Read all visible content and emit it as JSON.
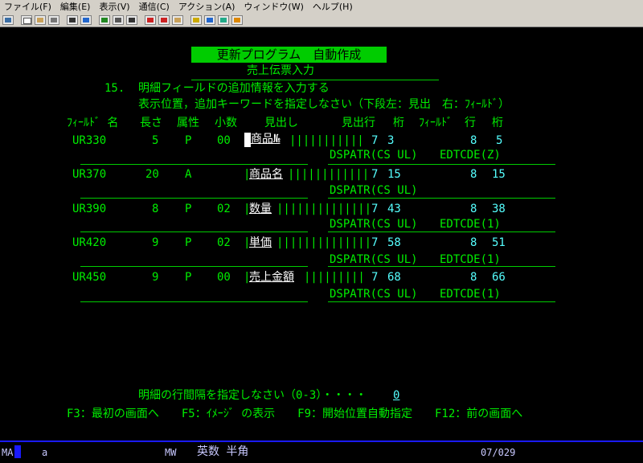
{
  "menu": [
    "ファイル(F)",
    "編集(E)",
    "表示(V)",
    "通信(C)",
    "アクション(A)",
    "ウィンドウ(W)",
    "ヘルプ(H)"
  ],
  "toolbar_icons": [
    "session-icon",
    "copy-icon",
    "paste-icon",
    "print-icon",
    "keyboard-icon",
    "macro-icon",
    "play-icon",
    "record-icon",
    "stop-icon",
    "transfer-icon",
    "receive-icon",
    "send-icon",
    "settings-icon",
    "help-icon",
    "globe-icon",
    "pencil-icon"
  ],
  "screen": {
    "title": "更新プログラム　自動作成",
    "subtitle": "売上伝票入力",
    "step": "15.",
    "instruction1": "明細フィールドの追加情報を入力する",
    "instruction2": "表示位置，追加キーワードを指定しなさい（下段左：見出　右：ﾌｨｰﾙﾄﾞ）",
    "headers": {
      "field_name": "ﾌｨｰﾙﾄﾞ 名",
      "length": "長さ",
      "attr": "属性",
      "decimal": "小数",
      "heading": "見出し",
      "heading_row": "見出行",
      "col1": "桁",
      "field": "ﾌｨｰﾙﾄﾞ",
      "row": "行",
      "col2": "桁"
    },
    "rows": [
      {
        "field": "UR330",
        "len": "5",
        "attr": "P",
        "dec": "00",
        "heading": "商品№",
        "hrow": "7",
        "hcol": "3",
        "frow": "8",
        "fcol": "5",
        "dspatr": "DSPATR(CS UL)",
        "edtcde": "EDTCDE(Z)"
      },
      {
        "field": "UR370",
        "len": "20",
        "attr": "A",
        "dec": "",
        "heading": "商品名",
        "hrow": "7",
        "hcol": "15",
        "frow": "8",
        "fcol": "15",
        "dspatr": "DSPATR(CS UL)",
        "edtcde": ""
      },
      {
        "field": "UR390",
        "len": "8",
        "attr": "P",
        "dec": "02",
        "heading": "数量",
        "hrow": "7",
        "hcol": "43",
        "frow": "8",
        "fcol": "38",
        "dspatr": "DSPATR(CS UL)",
        "edtcde": "EDTCDE(1)"
      },
      {
        "field": "UR420",
        "len": "9",
        "attr": "P",
        "dec": "02",
        "heading": "単価",
        "hrow": "7",
        "hcol": "58",
        "frow": "8",
        "fcol": "51",
        "dspatr": "DSPATR(CS UL)",
        "edtcde": "EDTCDE(1)"
      },
      {
        "field": "UR450",
        "len": "9",
        "attr": "P",
        "dec": "00",
        "heading": "売上金額",
        "hrow": "7",
        "hcol": "68",
        "frow": "8",
        "fcol": "66",
        "dspatr": "DSPATR(CS UL)",
        "edtcde": "EDTCDE(1)"
      }
    ],
    "spacing_prompt": "明細の行間隔を指定しなさい（0-3）・・・・",
    "spacing_value": "0",
    "fkeys": "F3：最初の画面へ　　F5：ｲﾒｰｼﾞ の表示　　F9：開始位置自動指定　　F12：前の画面へ"
  },
  "status": {
    "mode": "MA",
    "cursor_char": "a",
    "mw": "MW",
    "ime": "英数 半角",
    "position": "07/029"
  }
}
